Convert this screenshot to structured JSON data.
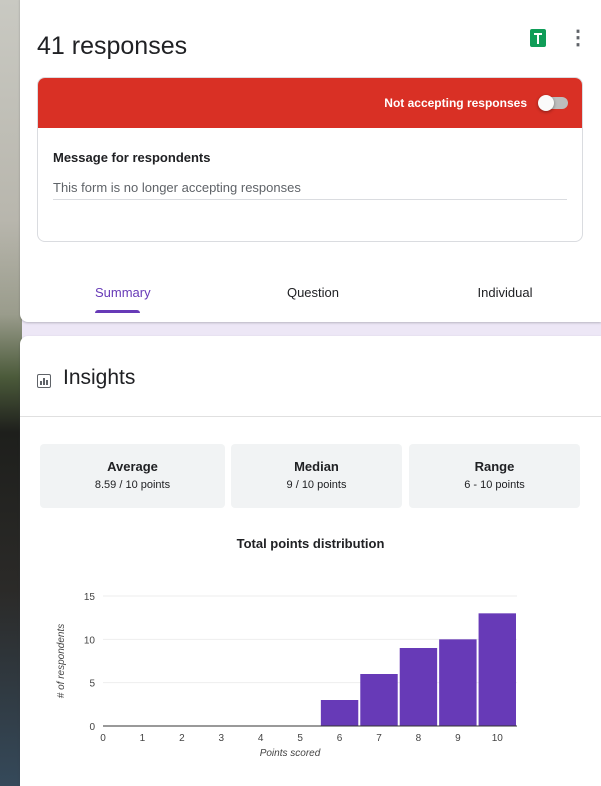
{
  "header": {
    "title": "41 responses",
    "sheets_icon": "google-sheets-icon",
    "more_icon": "more-vert-icon"
  },
  "responses": {
    "toggle_label": "Not accepting responses",
    "accepting": false,
    "message_label": "Message for respondents",
    "message_value": "This form is no longer accepting responses",
    "bar_color": "#d93025"
  },
  "tabs": [
    {
      "label": "Summary",
      "active": true
    },
    {
      "label": "Question",
      "active": false
    },
    {
      "label": "Individual",
      "active": false
    }
  ],
  "insights": {
    "title": "Insights",
    "icon": "bar-chart-icon",
    "stats": [
      {
        "label": "Average",
        "value": "8.59 / 10 points"
      },
      {
        "label": "Median",
        "value": "9 / 10 points"
      },
      {
        "label": "Range",
        "value": "6 - 10 points"
      }
    ]
  },
  "colors": {
    "accent": "#673ab7",
    "bar": "#673ab7"
  },
  "chart_data": {
    "type": "bar",
    "title": "Total points distribution",
    "xlabel": "Points scored",
    "ylabel": "# of respondents",
    "categories": [
      "0",
      "1",
      "2",
      "3",
      "4",
      "5",
      "6",
      "7",
      "8",
      "9",
      "10"
    ],
    "values": [
      0,
      0,
      0,
      0,
      0,
      0,
      3,
      6,
      9,
      10,
      13
    ],
    "yticks": [
      "0",
      "5",
      "10",
      "15"
    ],
    "ylim": [
      0,
      15
    ],
    "grid": true
  }
}
